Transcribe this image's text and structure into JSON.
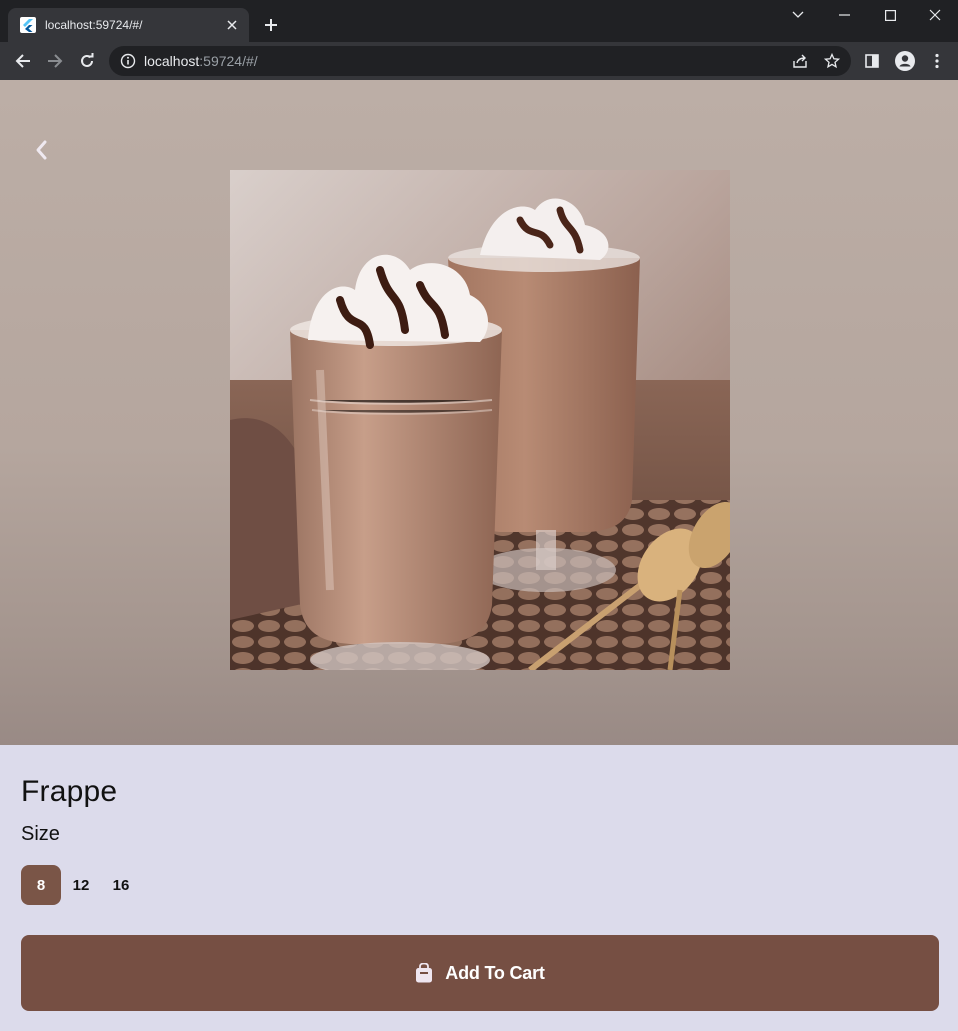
{
  "browser": {
    "tab_title": "localhost:59724/#/",
    "url_host": "localhost",
    "url_rest": ":59724/#/"
  },
  "product": {
    "name": "Frappe",
    "image_alt": "frappe-photo",
    "size_label": "Size",
    "sizes": [
      "8",
      "12",
      "16"
    ],
    "selected_size": "8",
    "add_to_cart_label": "Add To Cart"
  },
  "colors": {
    "accent": "#764f43",
    "selected_size_bg": "#7a5547",
    "details_bg": "#dcdbeb",
    "hero_bg": "#b8aaa2"
  }
}
